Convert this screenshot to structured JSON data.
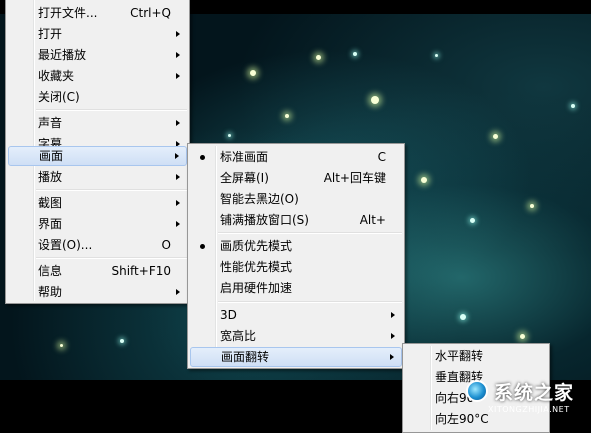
{
  "main_menu": {
    "items": [
      {
        "label": "打开文件...",
        "shortcut": "Ctrl+Q"
      },
      {
        "label": "打开"
      },
      {
        "label": "最近播放"
      },
      {
        "label": "收藏夹"
      },
      {
        "label": "关闭(C)"
      },
      {
        "label": "声音"
      },
      {
        "label": "字幕"
      },
      {
        "label": "画面"
      },
      {
        "label": "播放"
      },
      {
        "label": "截图"
      },
      {
        "label": "界面"
      },
      {
        "label": "设置(O)...",
        "shortcut": "O"
      },
      {
        "label": "信息",
        "shortcut": "Shift+F10"
      },
      {
        "label": "帮助"
      }
    ]
  },
  "picture_menu": {
    "items": [
      {
        "label": "标准画面",
        "shortcut": "C"
      },
      {
        "label": "全屏幕(I)",
        "shortcut": "Alt+回车键"
      },
      {
        "label": "智能去黑边(O)"
      },
      {
        "label": "铺满播放窗口(S)",
        "shortcut": "Alt+"
      },
      {
        "label": "画质优先模式"
      },
      {
        "label": "性能优先模式"
      },
      {
        "label": "启用硬件加速"
      },
      {
        "label": "3D"
      },
      {
        "label": "宽高比"
      },
      {
        "label": "画面翻转"
      }
    ]
  },
  "flip_menu": {
    "items": [
      {
        "label": "水平翻转"
      },
      {
        "label": "垂直翻转"
      },
      {
        "label": "向右90°"
      },
      {
        "label": "向左90°C"
      }
    ]
  },
  "watermark": {
    "text": "系统之家",
    "url": "XITONGZHIJIA.NET"
  }
}
